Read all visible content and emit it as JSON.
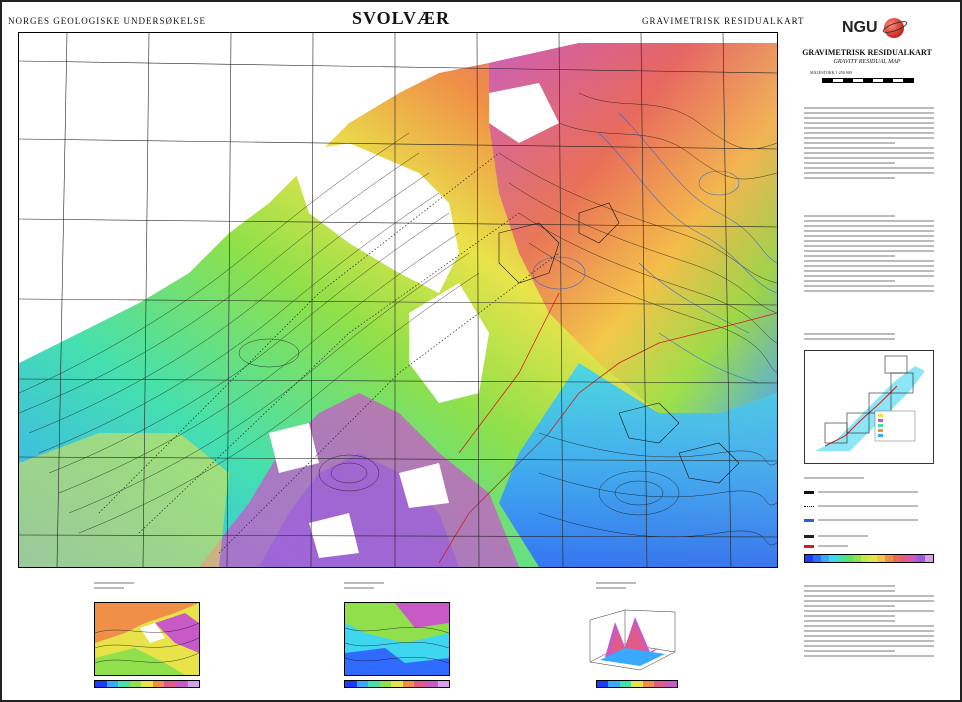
{
  "header": {
    "left": "NORGES GEOLOGISKE UNDERSØKELSE",
    "center": "SVOLVÆR",
    "right": "GRAVIMETRISK RESIDUALKART"
  },
  "sidebar": {
    "logo_text": "NGU",
    "title": "GRAVIMETRISK RESIDUALKART",
    "subtitle": "GRAVITY RESIDUAL MAP",
    "scale_label": "MÅLESTOKK 1:250 000"
  },
  "colors": {
    "map_palette": [
      "#1a3cff",
      "#2f6bff",
      "#39a8ff",
      "#3fd6f0",
      "#45e0b0",
      "#5fe06a",
      "#8fe04a",
      "#c6e84a",
      "#e9e34a",
      "#f5c34a",
      "#f09048",
      "#e86a5a",
      "#e05a8a",
      "#c85ac8",
      "#9a5ae0",
      "#d8a0e8"
    ],
    "coast": "#d02020",
    "contour": "#111111",
    "blue_contour": "#2a5fd8"
  },
  "icons": {
    "logo": "ngu-globe-icon"
  }
}
